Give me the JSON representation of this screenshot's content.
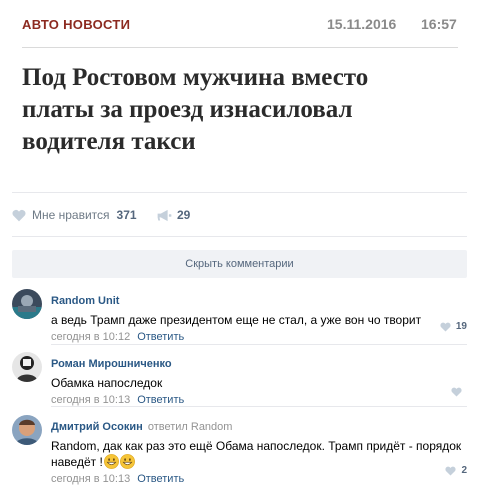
{
  "article": {
    "rubric": "АВТО НОВОСТИ",
    "date": "15.11.2016",
    "time": "16:57",
    "headline": "Под Ростовом мужчина вместо платы за проезд изнасиловал водителя такси"
  },
  "stats": {
    "like_label": "Мне нравится",
    "like_count": "371",
    "share_count": "29"
  },
  "hide_comments_label": "Скрыть комментарии",
  "comments": [
    {
      "author": "Random Unit",
      "replied": "",
      "text": "а ведь Трамп даже президентом еще не стал, а уже вон чо творит",
      "date": "сегодня в 10:12",
      "reply_label": "Ответить",
      "likes": "19"
    },
    {
      "author": "Роман Мирошниченко",
      "replied": "",
      "text": "Обамка напоследок",
      "date": "сегодня в 10:13",
      "reply_label": "Ответить",
      "likes": ""
    },
    {
      "author": "Дмитрий Осокин",
      "replied": "ответил Random",
      "text": "Random, дак как раз это ещё Обама напоследок. Трамп придёт - порядок наведёт !",
      "date": "сегодня в 10:13",
      "reply_label": "Ответить",
      "likes": "2"
    }
  ],
  "icons": {
    "like": "heart-icon",
    "share": "megaphone-icon",
    "emoji": "grinning-face-emoji"
  },
  "colors": {
    "rubric": "#8c2a20",
    "link": "#2a5885",
    "muted": "#939393",
    "icon": "#c5d0db"
  }
}
